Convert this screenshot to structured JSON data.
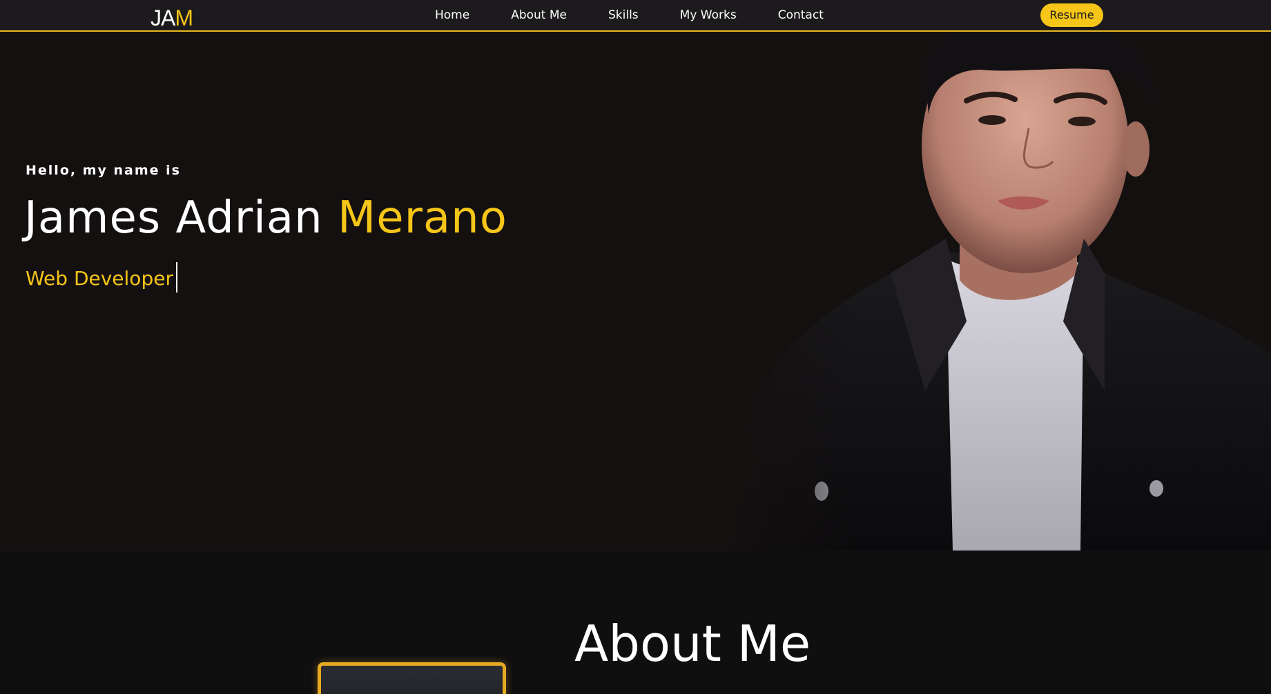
{
  "navbar": {
    "logo_part1": "JA",
    "logo_part2": "M",
    "links": [
      "Home",
      "About Me",
      "Skills",
      "My Works",
      "Contact"
    ],
    "resume_label": "Resume"
  },
  "hero": {
    "greeting": "Hello, my name is",
    "first_names": "James Adrian",
    "last_name": "Merano",
    "role": "Web Developer"
  },
  "about": {
    "title": "About Me"
  },
  "colors": {
    "accent": "#f5c518",
    "background": "#141010",
    "navbar": "#1c1a1c"
  }
}
